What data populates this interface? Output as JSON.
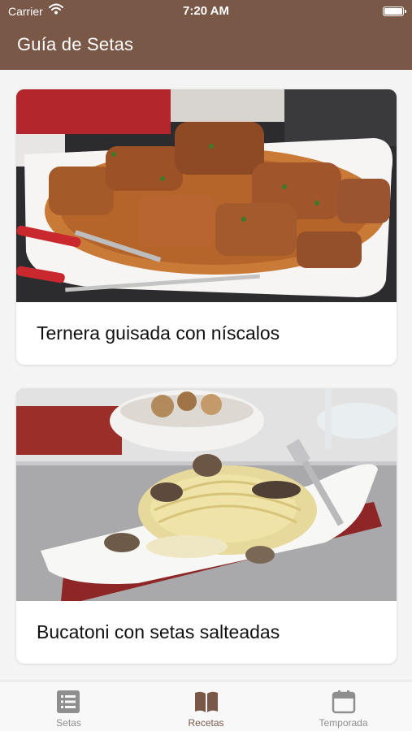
{
  "status_bar": {
    "carrier": "Carrier",
    "time": "7:20 AM"
  },
  "header": {
    "title": "Guía de Setas"
  },
  "recipes": [
    {
      "title": "Ternera guisada con níscalos",
      "image": "beef-stew-with-mushrooms-photo"
    },
    {
      "title": "Bucatoni con setas salteadas",
      "image": "pasta-with-sauteed-mushrooms-photo"
    }
  ],
  "tabs": [
    {
      "label": "Setas",
      "icon": "list-icon",
      "active": false
    },
    {
      "label": "Recetas",
      "icon": "book-icon",
      "active": true
    },
    {
      "label": "Temporada",
      "icon": "calendar-icon",
      "active": false
    }
  ],
  "colors": {
    "header": "#7a5848",
    "active_tab": "#7a5848",
    "inactive_tab": "#8e8e8e",
    "background": "#f4f4f4"
  }
}
